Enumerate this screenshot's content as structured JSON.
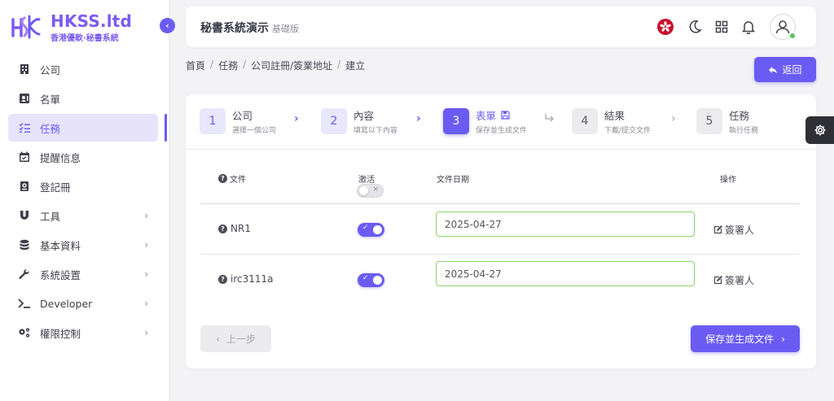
{
  "brand": {
    "name": "HKSS.ltd",
    "tagline": "香港優軟·秘書系統",
    "color": "#7b5cf0"
  },
  "colors": {
    "accent": "#6a5cf2",
    "input_border": "#8ad36a",
    "online": "#58c55a"
  },
  "sidebar": {
    "collapse_icon": "chevron-left-icon",
    "items": [
      {
        "label": "公司",
        "icon": "building-icon",
        "active": false,
        "has_children": false
      },
      {
        "label": "名單",
        "icon": "contact-card-icon",
        "active": false,
        "has_children": false
      },
      {
        "label": "任務",
        "icon": "checklist-icon",
        "active": true,
        "has_children": false
      },
      {
        "label": "提醒信息",
        "icon": "calendar-icon",
        "active": false,
        "has_children": false
      },
      {
        "label": "登記冊",
        "icon": "register-book-icon",
        "active": false,
        "has_children": false
      },
      {
        "label": "工具",
        "icon": "magnet-icon",
        "active": false,
        "has_children": true
      },
      {
        "label": "基本資料",
        "icon": "database-icon",
        "active": false,
        "has_children": true
      },
      {
        "label": "系統設置",
        "icon": "wrench-icon",
        "active": false,
        "has_children": true
      },
      {
        "label": "Developer",
        "icon": "terminal-icon",
        "active": false,
        "has_children": true
      },
      {
        "label": "權限控制",
        "icon": "gears-icon",
        "active": false,
        "has_children": true
      }
    ]
  },
  "header": {
    "title": "秘書系統演示",
    "edition": "基礎版",
    "icons": [
      "hk-flag-icon",
      "moon-icon",
      "grid-icon",
      "bell-icon",
      "user-avatar-icon"
    ]
  },
  "breadcrumb": [
    "首頁",
    "任務",
    "公司註冊/簽業地址",
    "建立"
  ],
  "back_button": {
    "label": "返回",
    "icon": "reply-arrow-icon"
  },
  "stepper": [
    {
      "num": "1",
      "title": "公司",
      "subtitle": "選擇一個公司",
      "state": "done"
    },
    {
      "num": "2",
      "title": "內容",
      "subtitle": "填寫以下內容",
      "state": "done"
    },
    {
      "num": "3",
      "title": "表單",
      "subtitle": "保存並生成文件",
      "state": "active",
      "icon": "save-icon"
    },
    {
      "num": "4",
      "title": "結果",
      "subtitle": "下載/提交文件",
      "state": "pending"
    },
    {
      "num": "5",
      "title": "任務",
      "subtitle": "執行任務",
      "state": "pending"
    }
  ],
  "table": {
    "headers": {
      "file": "文件",
      "active": "激活",
      "date": "文件日期",
      "action": "操作"
    },
    "rows": [
      {
        "name": "NR1",
        "active": true,
        "date": "2025-04-27",
        "action": "簽署人"
      },
      {
        "name": "irc3111a",
        "active": true,
        "date": "2025-04-27",
        "action": "簽署人"
      }
    ]
  },
  "footer": {
    "prev_label": "上一步",
    "save_label": "保存並生成文件"
  },
  "settings_fab": {
    "icon": "gear-icon"
  }
}
